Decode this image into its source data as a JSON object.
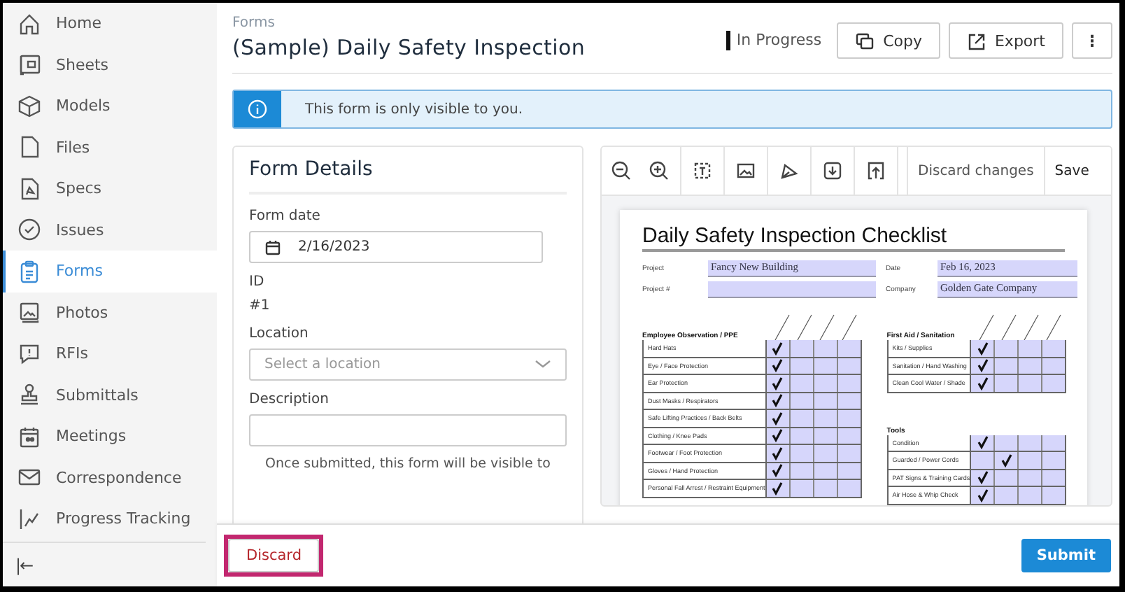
{
  "sidebar": {
    "items": [
      {
        "label": "Home",
        "selected": false
      },
      {
        "label": "Sheets",
        "selected": false
      },
      {
        "label": "Models",
        "selected": false
      },
      {
        "label": "Files",
        "selected": false
      },
      {
        "label": "Specs",
        "selected": false
      },
      {
        "label": "Issues",
        "selected": false
      },
      {
        "label": "Forms",
        "selected": true
      },
      {
        "label": "Photos",
        "selected": false
      },
      {
        "label": "RFIs",
        "selected": false
      },
      {
        "label": "Submittals",
        "selected": false
      },
      {
        "label": "Meetings",
        "selected": false
      },
      {
        "label": "Correspondence",
        "selected": false
      },
      {
        "label": "Progress Tracking",
        "selected": false
      }
    ],
    "collapse": "|←"
  },
  "header": {
    "breadcrumb": "Forms",
    "title": "(Sample) Daily Safety Inspection",
    "status": "In Progress",
    "buttons": [
      {
        "label": "Copy",
        "kind": "copy"
      },
      {
        "label": "Export",
        "kind": "export"
      },
      {
        "label": "⋮",
        "kind": "more"
      }
    ]
  },
  "banner": {
    "text": "This form is only visible to you."
  },
  "details": {
    "title": "Form Details",
    "fields": [
      {
        "kind": "date",
        "label": "Form date",
        "value": "2/16/2023"
      },
      {
        "kind": "text",
        "label": "ID",
        "value": "#1"
      },
      {
        "kind": "select",
        "label": "Location",
        "placeholder": "Select a location"
      },
      {
        "kind": "textarea",
        "label": "Description"
      }
    ],
    "note": "Once submitted, this form will be visible to"
  },
  "viewer": {
    "actions": [
      "Discard changes",
      "Save"
    ],
    "document": {
      "title": "Daily Safety Inspection Checklist",
      "fields": [
        {
          "label": "Project",
          "value": "Fancy New Building"
        },
        {
          "label": "Date",
          "value": "Feb 16, 2023"
        },
        {
          "label": "Project #"
        },
        {
          "label": "Company",
          "value": "Golden Gate Company"
        }
      ],
      "sections": [
        {
          "title": "Employee Observation / PPE",
          "rows": [
            {
              "item": "Hard Hats",
              "checks": [
                true,
                false,
                false,
                false
              ]
            },
            {
              "item": "Eye / Face Protection",
              "checks": [
                true,
                false,
                false,
                false
              ]
            },
            {
              "item": "Ear Protection",
              "checks": [
                true,
                false,
                false,
                false
              ]
            },
            {
              "item": "Dust Masks / Respirators",
              "checks": [
                true,
                false,
                false,
                false
              ]
            },
            {
              "item": "Safe Lifting Practices / Back Belts",
              "checks": [
                true,
                false,
                false,
                false
              ]
            },
            {
              "item": "Clothing / Knee Pads",
              "checks": [
                true,
                false,
                false,
                false
              ]
            },
            {
              "item": "Footwear / Foot Protection",
              "checks": [
                true,
                false,
                false,
                false
              ]
            },
            {
              "item": "Gloves / Hand Protection",
              "checks": [
                true,
                false,
                false,
                false
              ]
            },
            {
              "item": "Personal Fall Arrest / Restraint Equipment",
              "checks": [
                true,
                false,
                false,
                false
              ]
            }
          ]
        },
        {
          "title": "First Aid / Sanitation",
          "rows": [
            {
              "item": "Kits / Supplies",
              "checks": [
                true,
                false,
                false,
                false
              ]
            },
            {
              "item": "Sanitation / Hand Washing",
              "checks": [
                true,
                false,
                false,
                false
              ]
            },
            {
              "item": "Clean Cool Water / Shade",
              "checks": [
                true,
                false,
                false,
                false
              ]
            }
          ]
        },
        {
          "title": "Tools",
          "rows": [
            {
              "item": "Condition",
              "checks": [
                true,
                false,
                false,
                false
              ]
            },
            {
              "item": "Guarded / Power Cords",
              "checks": [
                false,
                true,
                false,
                false
              ]
            },
            {
              "item": "PAT Signs & Training Cards",
              "checks": [
                true,
                false,
                false,
                false
              ]
            },
            {
              "item": "Air Hose & Whip Check",
              "checks": [
                true,
                false,
                false,
                false
              ]
            }
          ]
        }
      ]
    }
  },
  "footer": {
    "discard": "Discard",
    "submit": "Submit"
  }
}
